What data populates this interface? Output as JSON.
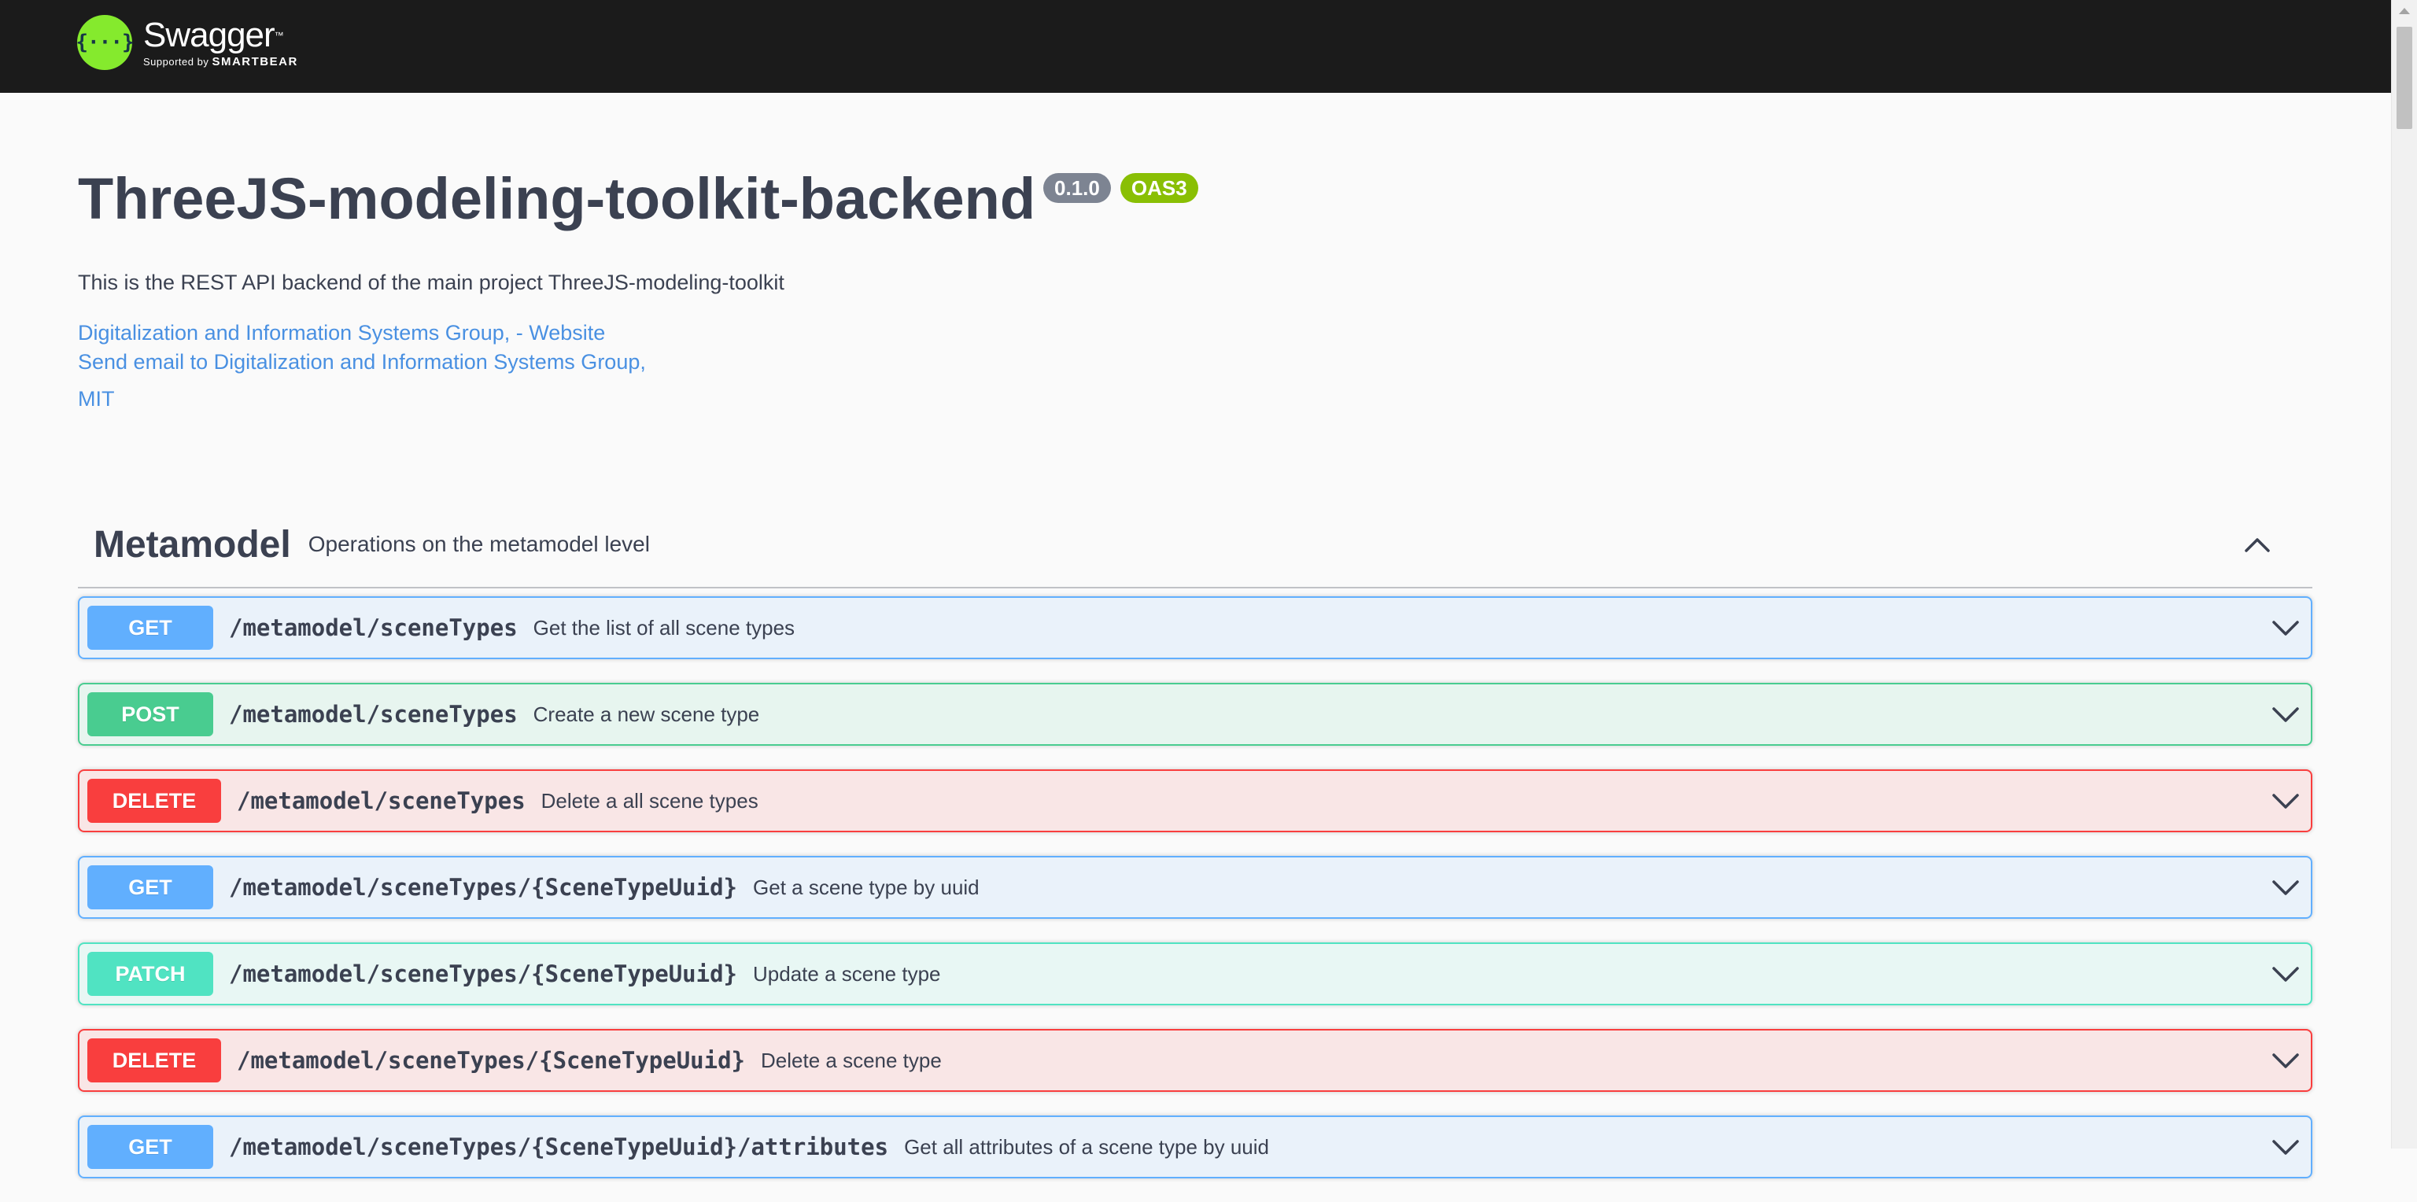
{
  "topbar": {
    "brand_logo_glyph": "{···}",
    "brand_name": "Swagger",
    "brand_tm": "™",
    "brand_supported": "Supported by ",
    "brand_company": "SMARTBEAR"
  },
  "info": {
    "title": "ThreeJS-modeling-toolkit-backend",
    "version": "0.1.0",
    "oas": "OAS3",
    "description": "This is the REST API backend of the main project ThreeJS-modeling-toolkit",
    "website_link": "Digitalization and Information Systems Group, - Website",
    "email_link": "Send email to Digitalization and Information Systems Group,",
    "license_link": "MIT"
  },
  "tag": {
    "name": "Metamodel",
    "description": "Operations on the metamodel level",
    "expanded": true
  },
  "operations": [
    {
      "method": "GET",
      "path": "/metamodel/sceneTypes",
      "summary": "Get the list of all scene types"
    },
    {
      "method": "POST",
      "path": "/metamodel/sceneTypes",
      "summary": "Create a new scene type"
    },
    {
      "method": "DELETE",
      "path": "/metamodel/sceneTypes",
      "summary": "Delete a all scene types"
    },
    {
      "method": "GET",
      "path": "/metamodel/sceneTypes/{SceneTypeUuid}",
      "summary": "Get a scene type by uuid"
    },
    {
      "method": "PATCH",
      "path": "/metamodel/sceneTypes/{SceneTypeUuid}",
      "summary": "Update a scene type"
    },
    {
      "method": "DELETE",
      "path": "/metamodel/sceneTypes/{SceneTypeUuid}",
      "summary": "Delete a scene type"
    },
    {
      "method": "GET",
      "path": "/metamodel/sceneTypes/{SceneTypeUuid}/attributes",
      "summary": "Get all attributes of a scene type by uuid"
    }
  ],
  "colors": {
    "get": "#61affe",
    "post": "#49cc90",
    "delete": "#f93e3e",
    "patch": "#50e3c2",
    "brand_green": "#85ea2d",
    "topbar": "#1b1b1b",
    "link": "#4990e2"
  },
  "icons": {
    "tag_toggle": "chevron-up-icon",
    "op_toggle": "chevron-down-icon"
  }
}
